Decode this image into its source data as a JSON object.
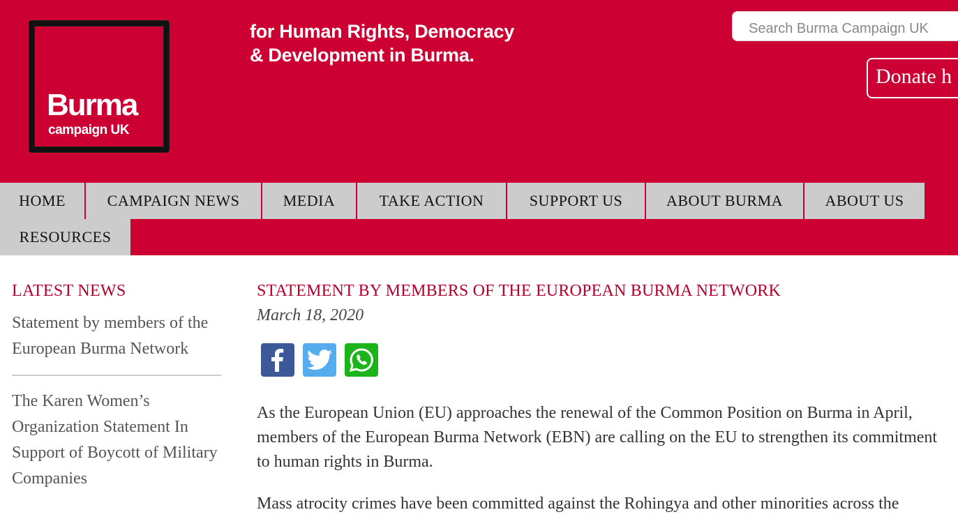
{
  "header": {
    "logo_line1": "Burma",
    "logo_line2": "campaign UK",
    "tagline_line1": "for Human Rights, Democracy",
    "tagline_line2": "& Development in Burma.",
    "search_placeholder": "Search Burma Campaign UK",
    "donate_label": "Donate h"
  },
  "nav": {
    "items": [
      {
        "label": "HOME"
      },
      {
        "label": "CAMPAIGN NEWS"
      },
      {
        "label": "MEDIA"
      },
      {
        "label": "TAKE ACTION"
      },
      {
        "label": "SUPPORT US"
      },
      {
        "label": "ABOUT BURMA"
      },
      {
        "label": "ABOUT US"
      },
      {
        "label": "RESOURCES"
      }
    ]
  },
  "sidebar": {
    "heading": "LATEST NEWS",
    "items": [
      {
        "title": "Statement by members of the European Burma Network"
      },
      {
        "title": "The Karen Women’s Organization Statement In Support of Boycott of Military Companies"
      }
    ]
  },
  "article": {
    "title": "STATEMENT BY MEMBERS OF THE EUROPEAN BURMA NETWORK",
    "date": "March 18, 2020",
    "share": [
      {
        "icon": "facebook-icon",
        "color": "#3b5998"
      },
      {
        "icon": "twitter-icon",
        "color": "#55acee"
      },
      {
        "icon": "whatsapp-icon",
        "color": "#1bb51b"
      }
    ],
    "paragraphs": [
      "As the European Union (EU) approaches the renewal of the Common Position on Burma in April, members of the European Burma Network (EBN) are calling on the EU to strengthen its commitment to human rights in Burma.",
      "Mass atrocity crimes have been committed against the Rohingya and other minorities across the"
    ]
  },
  "colors": {
    "brand_red": "#cc0033",
    "heading_red": "#b3002d",
    "nav_gray": "#cccccc"
  }
}
